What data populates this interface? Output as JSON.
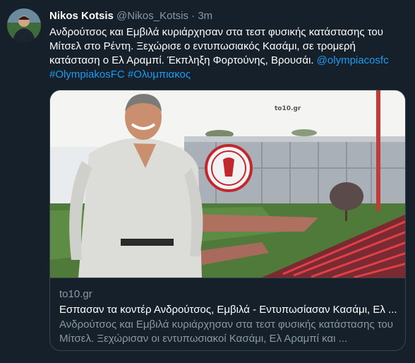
{
  "tweet": {
    "author_name": "Nikos Kotsis",
    "author_handle": "@Nikos_Kotsis",
    "separator": "·",
    "timestamp": "3m",
    "text": "Ανδρούτσος και Εμβιλά κυριάρχησαν στα τεστ φυσικής κατάστασης του Μίτσελ στο Ρέντη. Ξεχώρισε ο εντυπωσιακός Κασάμι, σε τρομερή κατάσταση ο Ελ Αραμπί. Έκπληξη Φορτούνης, Βρουσάι.",
    "mention": "@olympiacosfc",
    "hashtag_1": "#OlympiakosFC",
    "hashtag_2": "#Ολυμπιακος"
  },
  "card": {
    "domain": "to10.gr",
    "title": "Εσπασαν τα κοντέρ Ανδρούτσος, Εμβιλά - Εντυπωσίασαν Κασάμι, Ελ ...",
    "description": "Ανδρούτσος και Εμβιλά κυριάρχησαν στα τεστ φυσικής κατάστασης του Μίτσελ. Ξεχώρισαν οι εντυπωσιακοί Κασάμι, Ελ Αραμπί και ...",
    "image_watermark": "to10.gr"
  },
  "colors": {
    "background": "#15202b",
    "link": "#1d9bf0",
    "secondary_text": "#8899a6",
    "border": "#38444d"
  }
}
